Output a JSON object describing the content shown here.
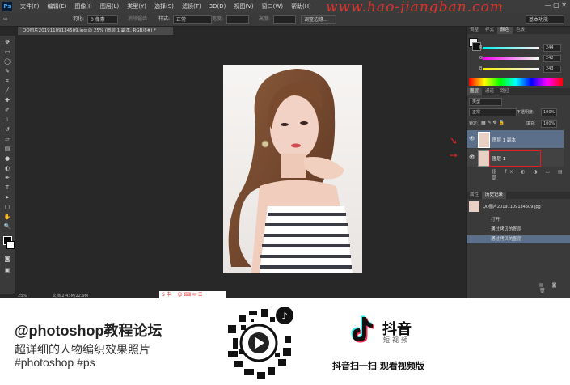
{
  "menubar": {
    "logo": "Ps",
    "items": [
      "文件(F)",
      "编辑(E)",
      "图像(I)",
      "图层(L)",
      "类型(Y)",
      "选择(S)",
      "滤镜(T)",
      "3D(D)",
      "视图(V)",
      "窗口(W)",
      "帮助(H)"
    ],
    "watermark": "www.hao-jiangban.com"
  },
  "options": {
    "feather_label": "羽化:",
    "feather_value": "0 像素",
    "antialias_label": "消除锯齿",
    "style_label": "样式:",
    "style_value": "正常",
    "width_label": "宽度:",
    "height_label": "高度:",
    "refine_edge": "调整边缘...",
    "workspace": "基本功能"
  },
  "document": {
    "tab_title": "QQ图片20191109134509.jpg @ 25% (图层 1 副本, RGB/8#) *",
    "zoom": "25%",
    "doc_info": "文档:2.43M/22.9M"
  },
  "panels": {
    "color_tabs": [
      "调整",
      "样式",
      "颜色",
      "色板"
    ],
    "color_active": "颜色",
    "rgb": [
      {
        "label": "R",
        "value": "244"
      },
      {
        "label": "G",
        "value": "242"
      },
      {
        "label": "B",
        "value": "243"
      }
    ],
    "layers_tabs": [
      "图层",
      "通道",
      "路径"
    ],
    "kind_label": "类型",
    "blend_mode": "正常",
    "opacity_label": "不透明度:",
    "opacity_value": "100%",
    "lock_label": "锁定:",
    "fill_label": "填充:",
    "fill_value": "100%",
    "layers": [
      {
        "name": "图层 1 副本",
        "selected": true
      },
      {
        "name": "图层 1",
        "selected": false
      }
    ],
    "history_tabs": [
      "属性",
      "历史记录"
    ],
    "history_source": "QQ图片20191109134509.jpg",
    "history_items": [
      "打开",
      "通过拷贝的图层",
      "通过拷贝的图层"
    ]
  },
  "promo": {
    "handle": "@photoshop教程论坛",
    "line2": "超详细的人物编织效果照片",
    "line3": "#photoshop #ps",
    "douyin_title": "抖音",
    "douyin_sub": "短视频",
    "douyin_bottom": "抖音扫一扫 观看视频版"
  },
  "colors": {
    "accent_red": "#e02020",
    "selected_layer": "#5b6f8a",
    "douyin_cyan": "#25f4ee",
    "douyin_pink": "#fe2c55"
  }
}
